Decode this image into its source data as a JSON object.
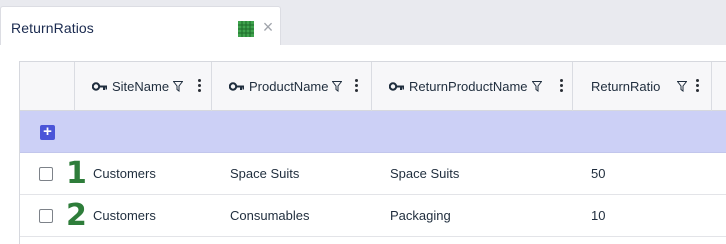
{
  "tab": {
    "title": "ReturnRatios",
    "close_icon": "×"
  },
  "columns": [
    {
      "label": "SiteName",
      "key": true,
      "filter": true
    },
    {
      "label": "ProductName",
      "key": true,
      "filter": true
    },
    {
      "label": "ReturnProductName",
      "key": true,
      "filter": true
    },
    {
      "label": "ReturnRatio",
      "key": false,
      "filter": true
    }
  ],
  "add_row": {
    "icon": "+"
  },
  "rows": [
    {
      "number": "1",
      "site": "Customers",
      "product": "Space Suits",
      "return_product": "Space Suits",
      "ratio": "50"
    },
    {
      "number": "2",
      "site": "Customers",
      "product": "Consumables",
      "return_product": "Packaging",
      "ratio": "10"
    }
  ],
  "colors": {
    "accent": "#4b55d8",
    "add_row_bg": "#ccd0f6",
    "row_number": "#2e7d3a",
    "grid_icon": "#3fa34d"
  }
}
